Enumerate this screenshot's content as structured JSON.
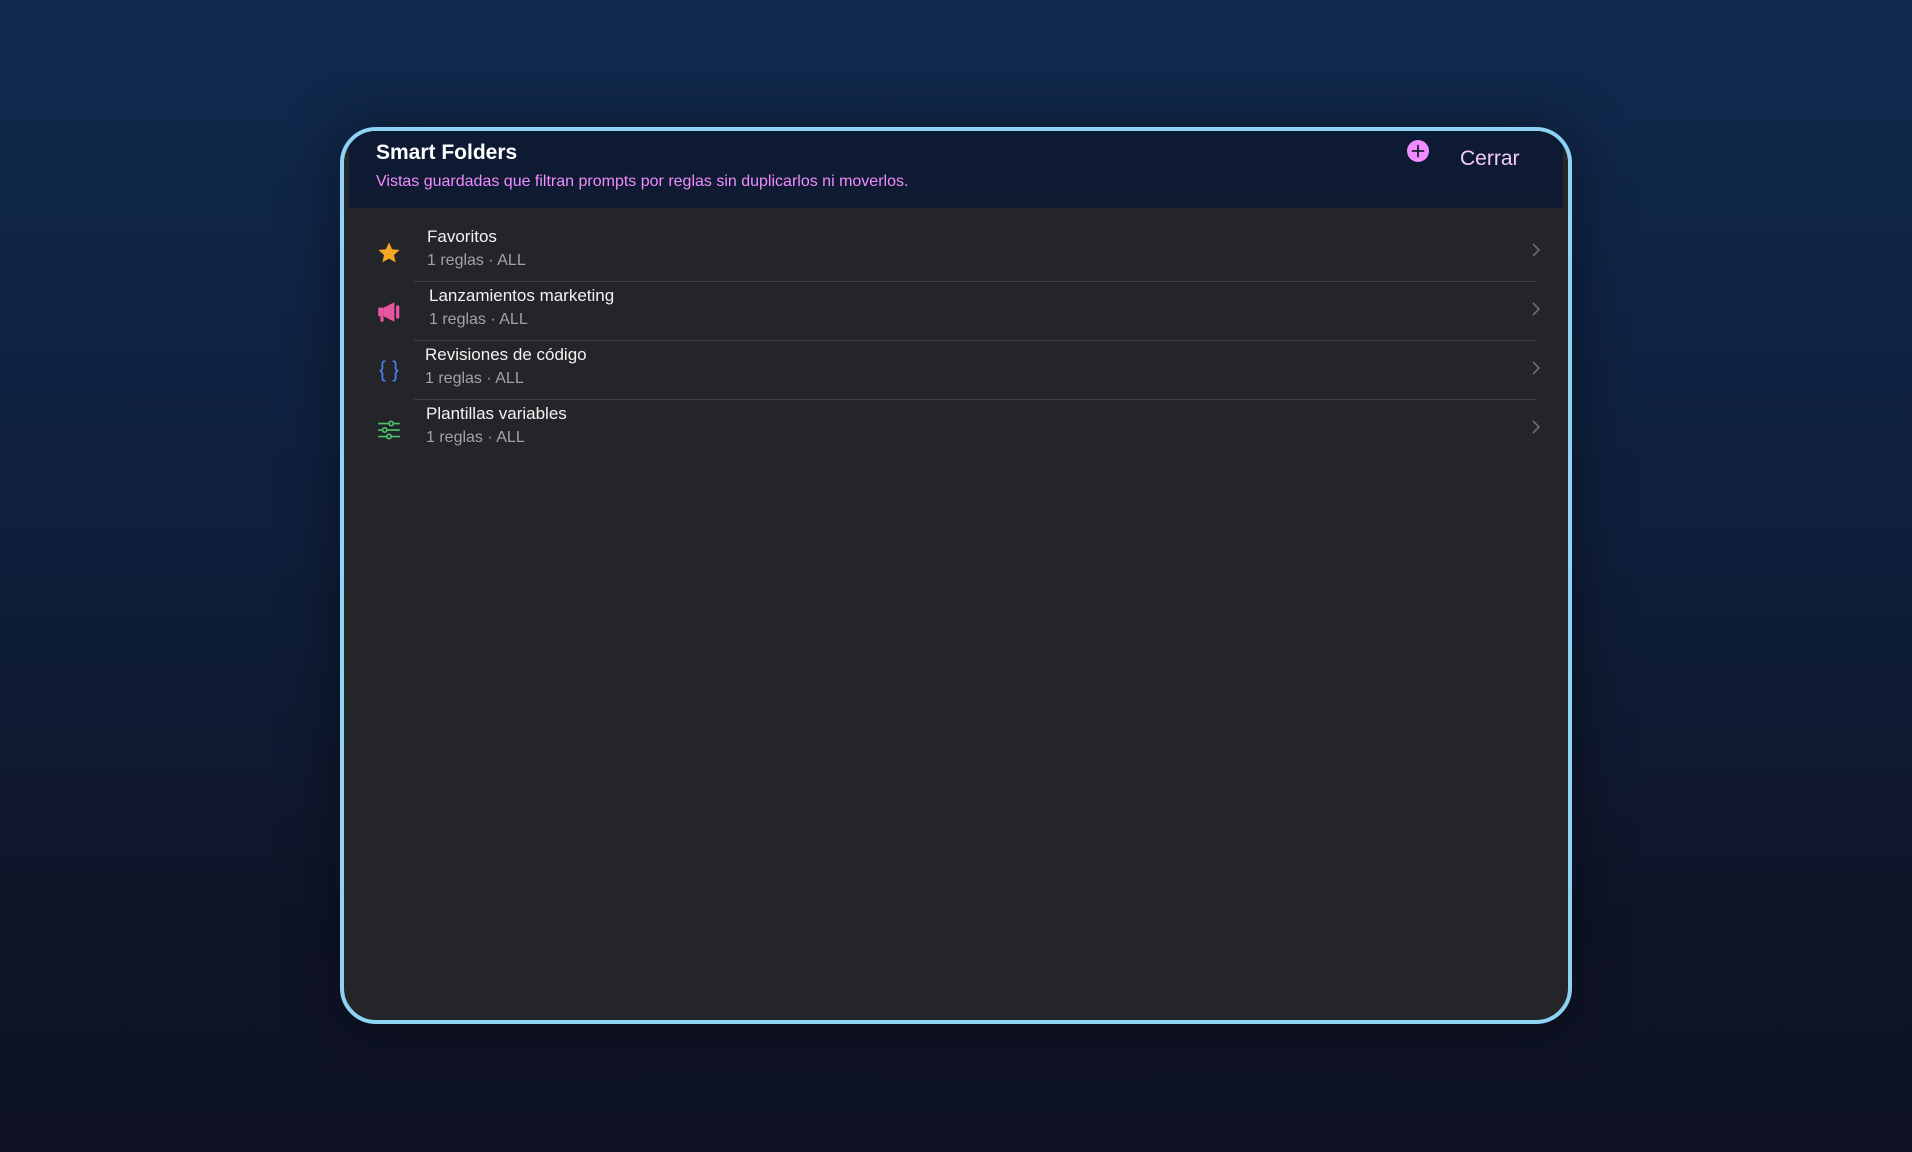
{
  "header": {
    "title": "Smart Folders",
    "subtitle": "Vistas guardadas que filtran prompts por reglas sin duplicarlos ni moverlos.",
    "add_icon": "plus-circle-icon",
    "close_label": "Cerrar"
  },
  "folders": [
    {
      "name": "Favoritos",
      "meta": "1 reglas · ALL",
      "icon": "star-icon",
      "color": "#f5a623"
    },
    {
      "name": "Lanzamientos marketing",
      "meta": "1 reglas · ALL",
      "icon": "megaphone-icon",
      "color": "#e9559f"
    },
    {
      "name": "Revisiones de código",
      "meta": "1 reglas · ALL",
      "icon": "curly-braces-icon",
      "color": "#4f7df2"
    },
    {
      "name": "Plantillas variables",
      "meta": "1 reglas · ALL",
      "icon": "sliders-icon",
      "color": "#4cc46a"
    }
  ],
  "colors": {
    "accent": "#f08cff",
    "border": "#8fd3f4",
    "background": "#232529"
  }
}
